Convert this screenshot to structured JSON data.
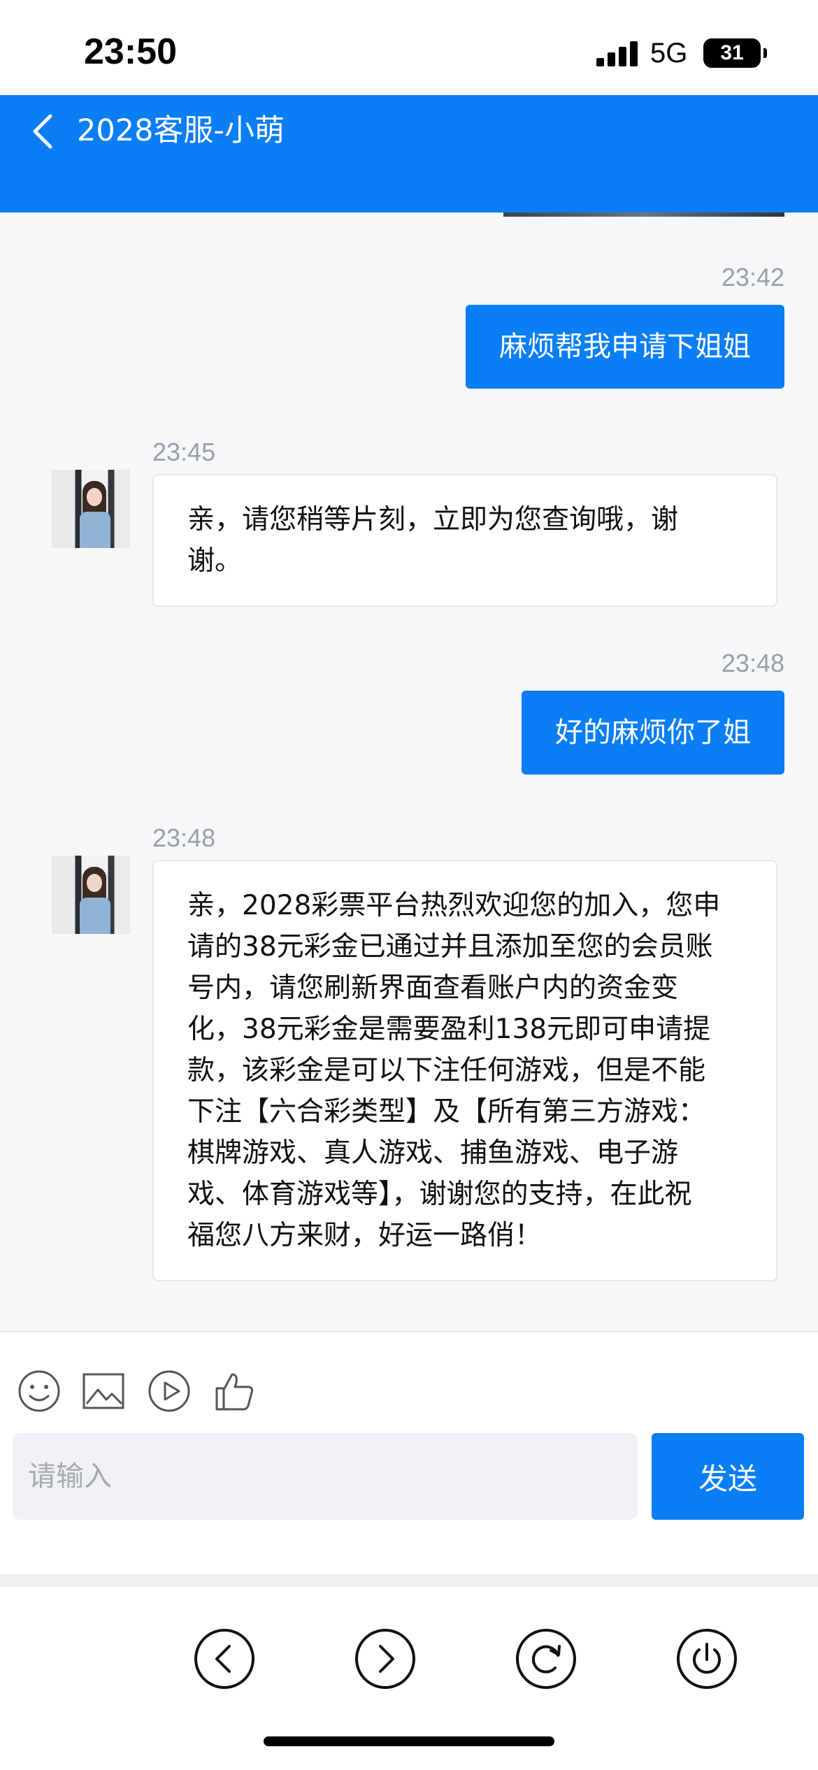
{
  "status_bar": {
    "time": "23:50",
    "network": "5G",
    "battery": "31"
  },
  "header": {
    "title": "2028客服-小萌"
  },
  "messages": [
    {
      "direction": "out",
      "time": "23:42",
      "text": "麻烦帮我申请下姐姐"
    },
    {
      "direction": "in",
      "time": "23:45",
      "lines": [
        "亲，请您稍等片刻，立即为您查询哦，谢",
        "谢。"
      ]
    },
    {
      "direction": "out",
      "time": "23:48",
      "text": "好的麻烦你了姐"
    },
    {
      "direction": "in",
      "time": "23:48",
      "lines": [
        "亲，2028彩票平台热烈欢迎您的加入，您申",
        "请的38元彩金已通过并且添加至您的会员账",
        "号内，请您刷新界面查看账户内的资金变",
        "化，38元彩金是需要盈利138元即可申请提",
        "款，该彩金是可以下注任何游戏，但是不能",
        "下注【六合彩类型】及【所有第三方游戏：",
        "棋牌游戏、真人游戏、捕鱼游戏、电子游",
        "戏、体育游戏等】，谢谢您的支持，在此祝",
        "福您八方来财，好运一路俏！"
      ]
    }
  ],
  "composer": {
    "tools": [
      "emoji-icon",
      "image-icon",
      "video-icon",
      "thumbs-up-icon"
    ],
    "input_placeholder": "请输入",
    "send_label": "发送"
  },
  "nav": [
    "back-icon",
    "forward-icon",
    "refresh-icon",
    "power-icon"
  ],
  "colors": {
    "accent": "#0a7ef5",
    "bubble_in": "#ffffff",
    "background": "#f6f7f9"
  }
}
